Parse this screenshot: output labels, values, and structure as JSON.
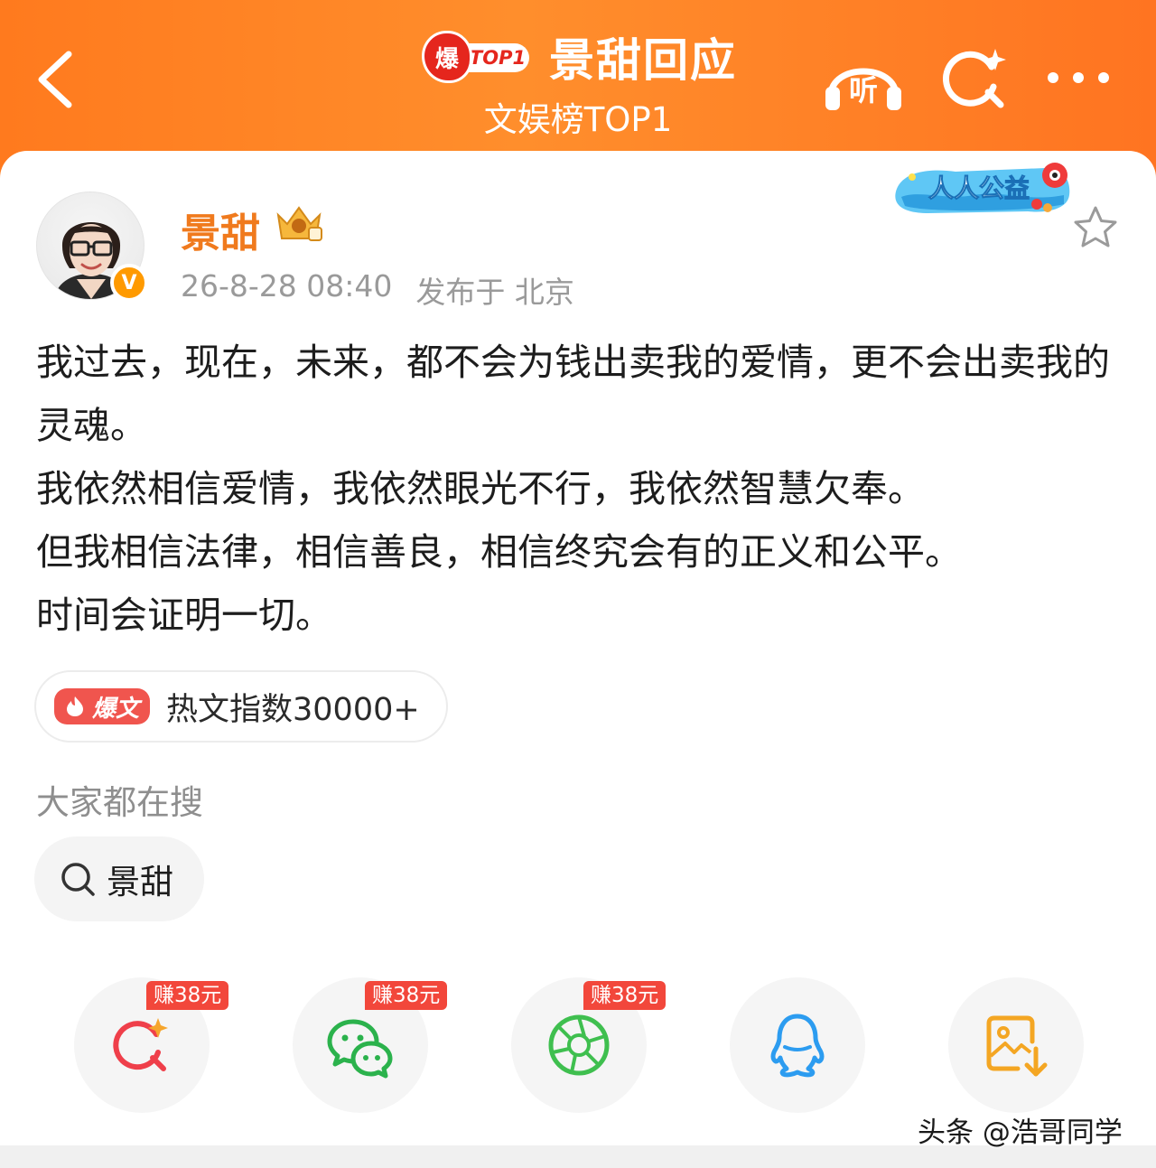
{
  "header": {
    "badge_char": "爆",
    "badge_label": "TOP1",
    "title": "景甜回应",
    "subtitle": "文娱榜TOP1",
    "listen_label": "听"
  },
  "post": {
    "username": "景甜",
    "verified_mark": "V",
    "timestamp": "26-8-28 08:40",
    "location": "发布于 北京",
    "charity_label": "人人公益",
    "paragraphs": [
      "我过去，现在，未来，都不会为钱出卖我的爱情，更不会出卖我的灵魂。",
      "我依然相信爱情，我依然眼光不行，我依然智慧欠奉。",
      "但我相信法律，相信善良，相信终究会有的正义和公平。",
      "时间会证明一切。"
    ],
    "hot_badge": "爆文",
    "hot_index": "热文指数30000+"
  },
  "related": {
    "heading": "大家都在搜",
    "chip": "景甜"
  },
  "share": {
    "items": [
      {
        "icon": "search-sparkle-icon",
        "reward": "赚38元"
      },
      {
        "icon": "wechat-icon",
        "reward": "赚38元"
      },
      {
        "icon": "moments-aperture-icon",
        "reward": "赚38元"
      },
      {
        "icon": "qq-icon",
        "reward": ""
      },
      {
        "icon": "save-image-icon",
        "reward": ""
      }
    ]
  },
  "watermark": "头条 @浩哥同学",
  "colors": {
    "header_orange": "#ff8a2a",
    "username_orange": "#f07a1d",
    "hot_red": "#f0554e",
    "reward_red": "#f2473b"
  }
}
